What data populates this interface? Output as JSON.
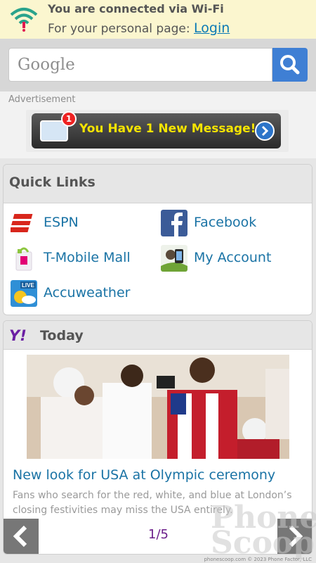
{
  "wifi": {
    "title": "You are connected via Wi-Fi",
    "subtitle": "For your personal page: ",
    "login_label": "Login"
  },
  "search": {
    "placeholder": "Google",
    "button_icon": "search-icon"
  },
  "ad": {
    "label": "Advertisement",
    "badge_count": "1",
    "message": "You Have 1 New Message!"
  },
  "quick_links": {
    "title": "Quick Links",
    "items": [
      {
        "label": "ESPN",
        "icon": "espn-icon"
      },
      {
        "label": "Facebook",
        "icon": "facebook-icon"
      },
      {
        "label": "T-Mobile Mall",
        "icon": "shopping-bag-icon"
      },
      {
        "label": "My Account",
        "icon": "account-icon"
      },
      {
        "label": "Accuweather",
        "icon": "weather-icon"
      }
    ]
  },
  "today": {
    "brand": "Y!",
    "title": "Today",
    "headline": "New look for USA at Olympic ceremony",
    "summary": "Fans who search for the red, white, and blue at London’s closing festivities may miss the USA entirely.",
    "pager": "1/5"
  },
  "watermark": {
    "line1": "Phone",
    "line2": "Scoop",
    "credit": "phonescoop.com  © 2023 Phone Factor, LLC"
  }
}
